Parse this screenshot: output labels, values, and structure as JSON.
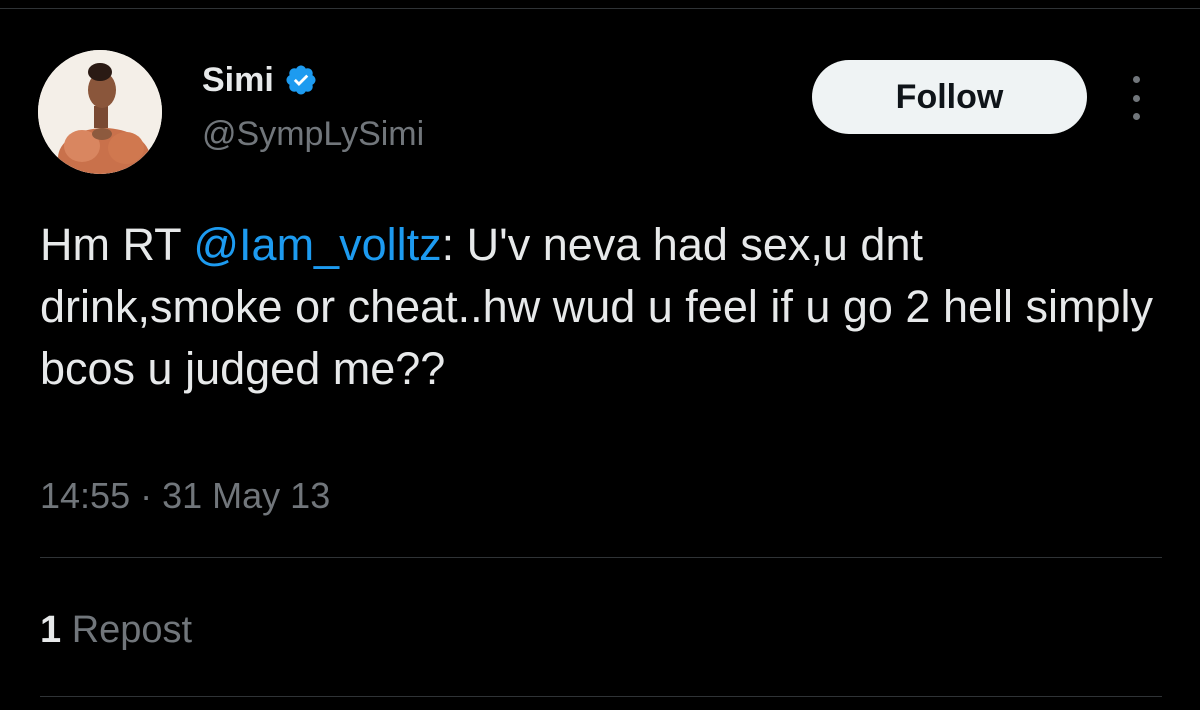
{
  "tweet": {
    "author": {
      "display_name": "Simi",
      "handle": "@SympLySimi",
      "verified": true,
      "avatar_icon": "profile-photo"
    },
    "follow_label": "Follow",
    "more_icon": "more-vertical-icon",
    "text": {
      "prefix": "Hm RT ",
      "mention": "@Iam_volltz",
      "body": ": U'v neva had sex,u dnt drink,smoke or cheat..hw wud u feel if u go 2 hell simply bcos u judged me??"
    },
    "time": "14:55",
    "separator": "·",
    "date": "31 May 13",
    "reposts": {
      "count": "1",
      "label": "Repost"
    }
  },
  "colors": {
    "background": "#000000",
    "text": "#e7e9ea",
    "muted": "#71767b",
    "accent": "#1d9bf0",
    "divider": "#2f3336",
    "follow_bg": "#eff3f4"
  }
}
